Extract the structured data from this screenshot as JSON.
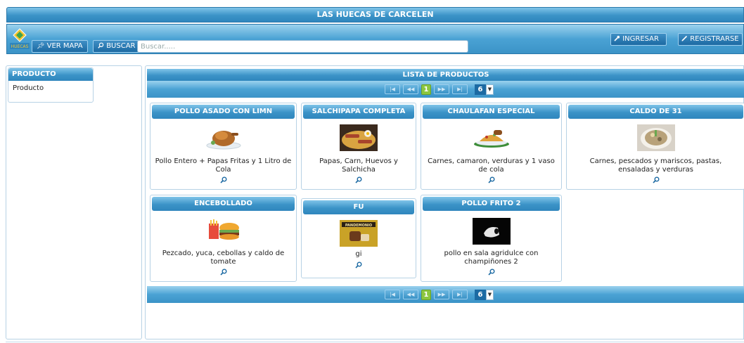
{
  "app": {
    "title": "LAS HUECAS DE CARCELEN"
  },
  "toolbar": {
    "map_label": "VER MAPA",
    "search_label": "BUSCAR",
    "search_placeholder": "Buscar.....",
    "login_label": "INGRESAR",
    "register_label": "REGISTRARSE",
    "logo_text": "HUECAS"
  },
  "sidebar": {
    "heading": "PRODUCTO",
    "items": [
      {
        "label": "Producto"
      }
    ]
  },
  "list": {
    "heading": "LISTA DE PRODUCTOS",
    "pager": {
      "current_page": "1",
      "page_size": "6"
    }
  },
  "products": [
    {
      "name": "POLLO ASADO CON LIMN",
      "description": "Pollo Entero + Papas Fritas y 1 Litro de Cola",
      "image": "roast-chicken-image"
    },
    {
      "name": "SALCHIPAPA COMPLETA",
      "description": "Papas, Carn, Huevos y Salchicha",
      "image": "salchipapa-image"
    },
    {
      "name": "CHAULAFAN ESPECIAL",
      "description": "Carnes, camaron, verduras y 1 vaso de cola",
      "image": "chaulafan-image"
    },
    {
      "name": "CALDO DE 31",
      "description": "Carnes, pescados y mariscos, pastas, ensaladas y verduras",
      "image": "soup-bowl-image"
    },
    {
      "name": "ENCEBOLLADO",
      "description": "Pezcado, yuca, cebollas y caldo de tomate",
      "image": "burger-fries-image"
    },
    {
      "name": "FU",
      "description": "gi",
      "image": "pandemonio-image"
    },
    {
      "name": "POLLO FRITO 2",
      "description": "pollo en sala agridulce con champiñones 2",
      "image": "dark-photo-image"
    }
  ],
  "colors": {
    "header_blue": "#3b93c7",
    "accent_green": "#8cc63f",
    "border": "#b7d2e5"
  },
  "icons": {
    "pin": "pin-icon",
    "search": "search-icon",
    "login": "key-icon",
    "register": "pencil-icon",
    "detail": "magnifier-icon"
  }
}
